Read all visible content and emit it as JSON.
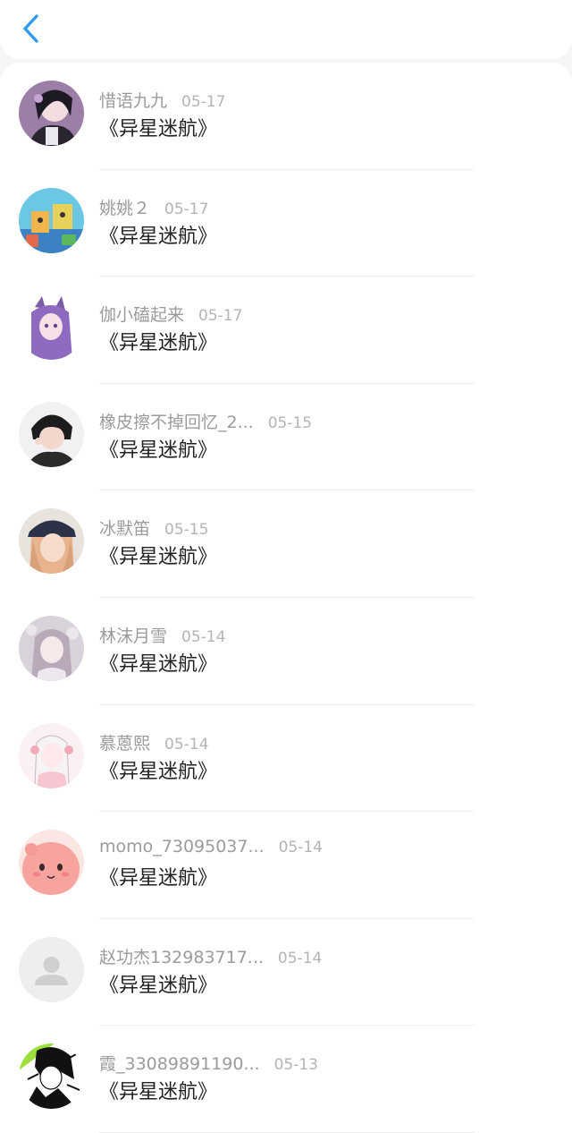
{
  "header": {
    "back_icon": "chevron-left-icon",
    "accent_color": "#2d9bf0"
  },
  "items": [
    {
      "username": "惜语九九",
      "date": "05-17",
      "title": "《异星迷航》"
    },
    {
      "username": "姚姚２",
      "date": "05-17",
      "title": "《异星迷航》"
    },
    {
      "username": "伽小磕起来",
      "date": "05-17",
      "title": "《异星迷航》"
    },
    {
      "username": "橡皮擦不掉回忆_2...",
      "date": "05-15",
      "title": "《异星迷航》"
    },
    {
      "username": "冰默笛",
      "date": "05-15",
      "title": "《异星迷航》"
    },
    {
      "username": "林沫月雪",
      "date": "05-14",
      "title": "《异星迷航》"
    },
    {
      "username": "慕蒽熙",
      "date": "05-14",
      "title": "《异星迷航》"
    },
    {
      "username": "momo_73095037...",
      "date": "05-14",
      "title": "《异星迷航》"
    },
    {
      "username": "赵功杰132983717...",
      "date": "05-14",
      "title": "《异星迷航》"
    },
    {
      "username": "霞_33089891190...",
      "date": "05-13",
      "title": "《异星迷航》"
    }
  ]
}
